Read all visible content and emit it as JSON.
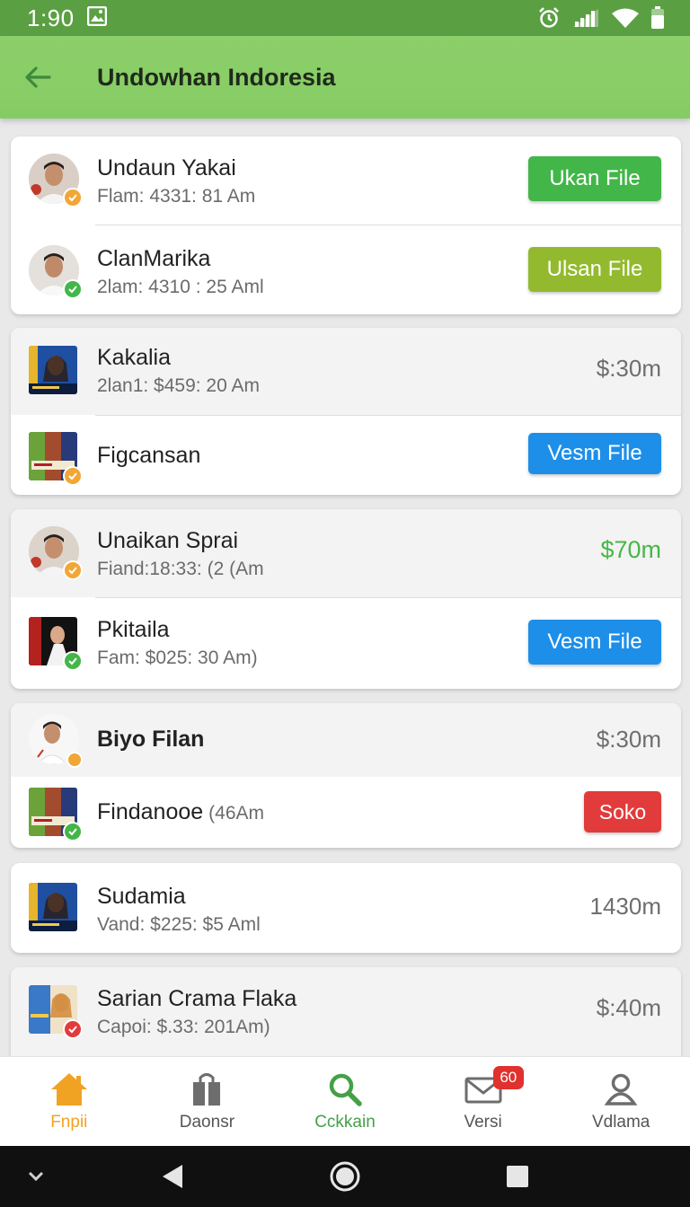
{
  "status_bar": {
    "time": "1:90"
  },
  "app_bar": {
    "title": "Undowhan Indoresia"
  },
  "items": [
    {
      "name": "Undaun Yakai",
      "sub": "Flam: 4331: 81 Am",
      "action": "Ukan File"
    },
    {
      "name": "ClanMarika",
      "sub": "2lam: 4310 : 25 Aml",
      "action": "Ulsan File"
    },
    {
      "name": "Kakalia",
      "sub": "2lan1: $459: 20 Am",
      "price": "$:30m"
    },
    {
      "name": "Figcansan",
      "action": "Vesm File"
    },
    {
      "name": "Unaikan Sprai",
      "sub": "Fiand:18:33: (2 (Am",
      "price": "$70m"
    },
    {
      "name": "Pkitaila",
      "sub": "Fam: $025: 30 Am)",
      "action": "Vesm File"
    },
    {
      "name": "Biyo Filan",
      "price": "$:30m"
    },
    {
      "name": "Findanooe",
      "sub": "(46Am",
      "action": "Soko"
    },
    {
      "name": "Sudamia",
      "sub": "Vand: $225: $5 Aml",
      "price": "1430m"
    },
    {
      "name": "Sarian Crama Flaka",
      "sub": "Capoi: $.33: 201Am)",
      "price": "$:40m"
    }
  ],
  "bottom_nav": [
    {
      "label": "Fnpii"
    },
    {
      "label": "Daonsr"
    },
    {
      "label": "Cckkain"
    },
    {
      "label": "Versi",
      "badge": "60"
    },
    {
      "label": "Vdlama"
    }
  ],
  "colors": {
    "status_bar": "#5aa043",
    "app_bar": "#8ccf6a",
    "button_green": "#43b649",
    "button_olive": "#93ba2f",
    "button_blue": "#1d8fe9",
    "button_red": "#e23b3b",
    "nav_home_active": "#f0a323",
    "nav_search": "#45a047"
  }
}
